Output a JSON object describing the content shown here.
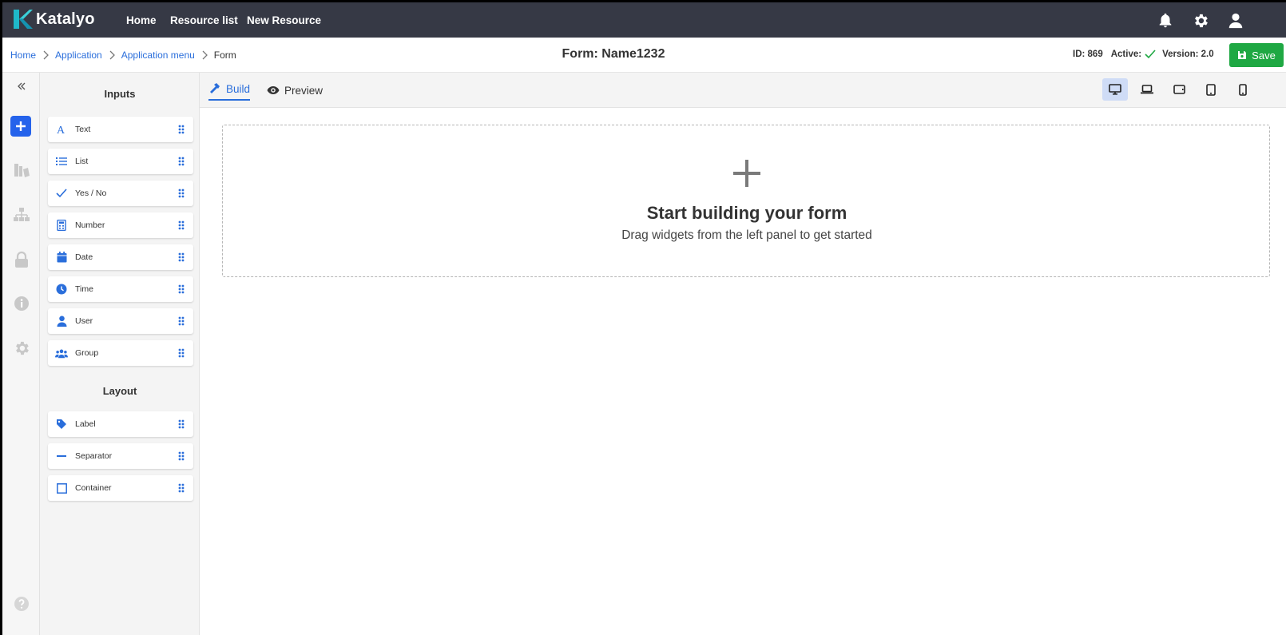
{
  "app": {
    "name": "Katalyo"
  },
  "nav": {
    "items": [
      "Home",
      "Resource list",
      "New Resource"
    ]
  },
  "breadcrumb": [
    "Home",
    "Application",
    "Application menu",
    "Form"
  ],
  "header": {
    "title": "Form: Name1232",
    "id_label": "ID: 869",
    "active_label": "Active:",
    "version_label": "Version: 2.0",
    "save_label": "Save"
  },
  "panel": {
    "inputs_title": "Inputs",
    "inputs": [
      {
        "label": "Text",
        "icon": "text-icon"
      },
      {
        "label": "List",
        "icon": "list-icon"
      },
      {
        "label": "Yes / No",
        "icon": "check-icon"
      },
      {
        "label": "Number",
        "icon": "calculator-icon"
      },
      {
        "label": "Date",
        "icon": "calendar-icon"
      },
      {
        "label": "Time",
        "icon": "clock-icon"
      },
      {
        "label": "User",
        "icon": "user-icon"
      },
      {
        "label": "Group",
        "icon": "group-icon"
      }
    ],
    "layout_title": "Layout",
    "layout": [
      {
        "label": "Label",
        "icon": "tag-icon"
      },
      {
        "label": "Separator",
        "icon": "minus-icon"
      },
      {
        "label": "Container",
        "icon": "square-icon"
      }
    ]
  },
  "tabs": {
    "build": "Build",
    "preview": "Preview"
  },
  "devices": [
    "desktop-icon",
    "laptop-icon",
    "tablet-landscape-icon",
    "tablet-icon",
    "mobile-icon"
  ],
  "dropzone": {
    "title": "Start building your form",
    "subtitle": "Drag widgets from the left panel to get started"
  },
  "colors": {
    "topbar": "#363945",
    "accent": "#2a6edb",
    "save": "#1fa843",
    "brand": "#1fb8c9"
  }
}
